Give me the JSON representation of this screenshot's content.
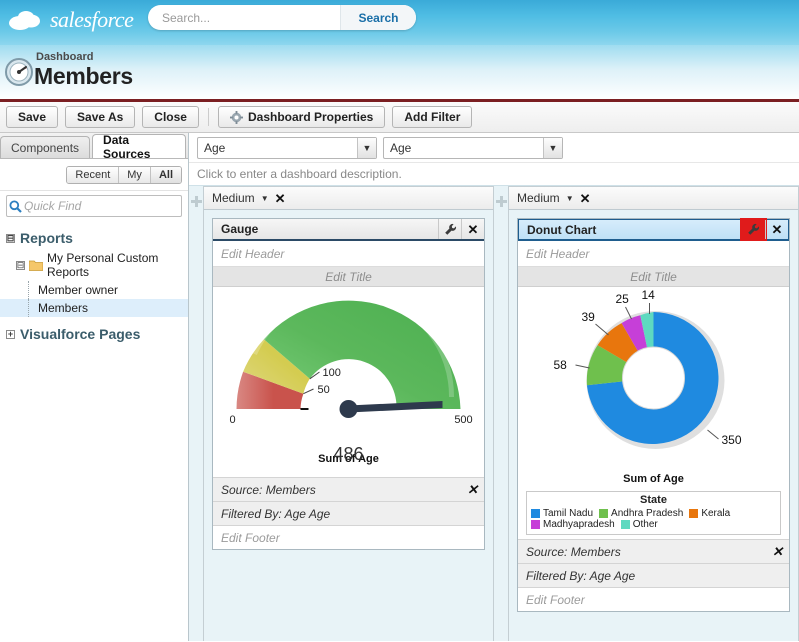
{
  "topbar": {
    "brand": "salesforce",
    "brand_icon": "cloud-logo",
    "search_placeholder": "Search...",
    "search_value": "",
    "search_button": "Search"
  },
  "subheader": {
    "kicker": "Dashboard",
    "title": "Members",
    "icon": "dashboard-gauge-icon"
  },
  "toolbar": {
    "buttons": [
      {
        "label": "Save",
        "icon": null
      },
      {
        "label": "Save As",
        "icon": null
      },
      {
        "label": "Close",
        "icon": null
      }
    ],
    "properties_label": "Dashboard Properties",
    "properties_icon": "gear-icon",
    "add_filter_label": "Add Filter"
  },
  "sidebar": {
    "tabs": [
      {
        "label": "Components",
        "active": false
      },
      {
        "label": "Data Sources",
        "active": true
      }
    ],
    "scope_filters": [
      {
        "label": "Recent",
        "active": false
      },
      {
        "label": "My",
        "active": false
      },
      {
        "label": "All",
        "active": true
      }
    ],
    "quick_find_placeholder": "Quick Find",
    "quick_find_value": "",
    "quick_find_icon": "search-icon",
    "tree": {
      "reports_label": "Reports",
      "folder_label": "My Personal Custom Reports",
      "folder_icon": "folder-icon",
      "items": [
        {
          "label": "Member owner",
          "selected": false
        },
        {
          "label": "Members",
          "selected": true
        }
      ],
      "visualforce_label": "Visualforce Pages"
    }
  },
  "canvas": {
    "filters": [
      {
        "value": "Age"
      },
      {
        "value": "Age"
      }
    ],
    "description_placeholder": "Click to enter a dashboard description."
  },
  "columns": [
    {
      "size_label": "Medium",
      "close_icon": "close-icon",
      "caret_icon": "chevron-down-icon",
      "component": {
        "title": "Gauge",
        "title_selected": false,
        "wrench_icon": "wrench-icon",
        "wrench_highlighted": false,
        "close_icon": "close-icon",
        "header_placeholder": "Edit Header",
        "title_placeholder": "Edit Title",
        "caption": "Sum of Age",
        "source_label": "Source: Members",
        "source_close_icon": "close-icon",
        "filtered_label": "Filtered By:  Age  Age",
        "footer_placeholder": "Edit Footer"
      }
    },
    {
      "size_label": "Medium",
      "close_icon": "close-icon",
      "caret_icon": "chevron-down-icon",
      "component": {
        "title": "Donut Chart",
        "title_selected": true,
        "wrench_icon": "wrench-icon",
        "wrench_highlighted": true,
        "close_icon": "close-icon",
        "header_placeholder": "Edit Header",
        "title_placeholder": "Edit Title",
        "caption": "Sum of Age",
        "source_label": "Source: Members",
        "source_close_icon": "close-icon",
        "filtered_label": "Filtered By:  Age  Age",
        "footer_placeholder": "Edit Footer"
      }
    }
  ],
  "chart_data": [
    {
      "type": "gauge",
      "title": "Sum of Age",
      "value": 486,
      "value_label": "486",
      "min": 0,
      "max": 500,
      "tick_labels": [
        "0",
        "50",
        "100",
        "500"
      ],
      "breakpoints": [
        0,
        50,
        100,
        500
      ],
      "segments": [
        {
          "from": 0,
          "to": 50,
          "color": "#c9534c"
        },
        {
          "from": 50,
          "to": 100,
          "color": "#d4cc50"
        },
        {
          "from": 100,
          "to": 500,
          "color": "#5cb85c"
        }
      ],
      "needle_color": "#2e3a4d"
    },
    {
      "type": "pie",
      "variant": "donut",
      "title": "Sum of Age",
      "legend_title": "State",
      "legend_position": "bottom",
      "labels": [
        "Tamil Nadu",
        "Andhra Pradesh",
        "Kerala",
        "Madhyapradesh",
        "Other"
      ],
      "values": [
        350,
        58,
        39,
        25,
        14
      ],
      "value_labels": [
        "350",
        "58",
        "39",
        "25",
        "14"
      ],
      "colors": [
        "#1f8ae0",
        "#6fc04d",
        "#e8760d",
        "#c63fd8",
        "#5ed9c0"
      ],
      "total": 486
    }
  ]
}
